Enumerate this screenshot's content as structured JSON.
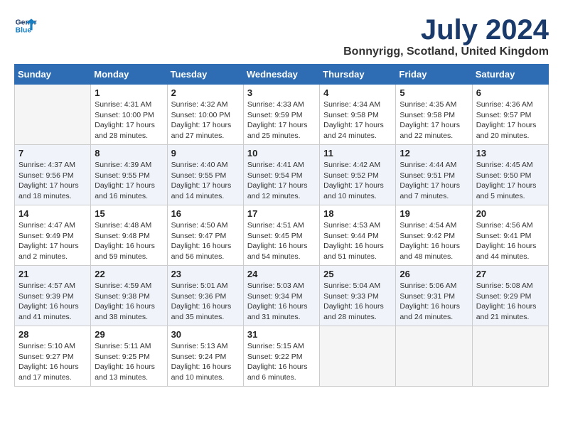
{
  "header": {
    "logo_line1": "General",
    "logo_line2": "Blue",
    "month_title": "July 2024",
    "location": "Bonnyrigg, Scotland, United Kingdom"
  },
  "days_of_week": [
    "Sunday",
    "Monday",
    "Tuesday",
    "Wednesday",
    "Thursday",
    "Friday",
    "Saturday"
  ],
  "weeks": [
    [
      {
        "num": "",
        "empty": true
      },
      {
        "num": "1",
        "sunrise": "Sunrise: 4:31 AM",
        "sunset": "Sunset: 10:00 PM",
        "daylight": "Daylight: 17 hours and 28 minutes."
      },
      {
        "num": "2",
        "sunrise": "Sunrise: 4:32 AM",
        "sunset": "Sunset: 10:00 PM",
        "daylight": "Daylight: 17 hours and 27 minutes."
      },
      {
        "num": "3",
        "sunrise": "Sunrise: 4:33 AM",
        "sunset": "Sunset: 9:59 PM",
        "daylight": "Daylight: 17 hours and 25 minutes."
      },
      {
        "num": "4",
        "sunrise": "Sunrise: 4:34 AM",
        "sunset": "Sunset: 9:58 PM",
        "daylight": "Daylight: 17 hours and 24 minutes."
      },
      {
        "num": "5",
        "sunrise": "Sunrise: 4:35 AM",
        "sunset": "Sunset: 9:58 PM",
        "daylight": "Daylight: 17 hours and 22 minutes."
      },
      {
        "num": "6",
        "sunrise": "Sunrise: 4:36 AM",
        "sunset": "Sunset: 9:57 PM",
        "daylight": "Daylight: 17 hours and 20 minutes."
      }
    ],
    [
      {
        "num": "7",
        "sunrise": "Sunrise: 4:37 AM",
        "sunset": "Sunset: 9:56 PM",
        "daylight": "Daylight: 17 hours and 18 minutes."
      },
      {
        "num": "8",
        "sunrise": "Sunrise: 4:39 AM",
        "sunset": "Sunset: 9:55 PM",
        "daylight": "Daylight: 17 hours and 16 minutes."
      },
      {
        "num": "9",
        "sunrise": "Sunrise: 4:40 AM",
        "sunset": "Sunset: 9:55 PM",
        "daylight": "Daylight: 17 hours and 14 minutes."
      },
      {
        "num": "10",
        "sunrise": "Sunrise: 4:41 AM",
        "sunset": "Sunset: 9:54 PM",
        "daylight": "Daylight: 17 hours and 12 minutes."
      },
      {
        "num": "11",
        "sunrise": "Sunrise: 4:42 AM",
        "sunset": "Sunset: 9:52 PM",
        "daylight": "Daylight: 17 hours and 10 minutes."
      },
      {
        "num": "12",
        "sunrise": "Sunrise: 4:44 AM",
        "sunset": "Sunset: 9:51 PM",
        "daylight": "Daylight: 17 hours and 7 minutes."
      },
      {
        "num": "13",
        "sunrise": "Sunrise: 4:45 AM",
        "sunset": "Sunset: 9:50 PM",
        "daylight": "Daylight: 17 hours and 5 minutes."
      }
    ],
    [
      {
        "num": "14",
        "sunrise": "Sunrise: 4:47 AM",
        "sunset": "Sunset: 9:49 PM",
        "daylight": "Daylight: 17 hours and 2 minutes."
      },
      {
        "num": "15",
        "sunrise": "Sunrise: 4:48 AM",
        "sunset": "Sunset: 9:48 PM",
        "daylight": "Daylight: 16 hours and 59 minutes."
      },
      {
        "num": "16",
        "sunrise": "Sunrise: 4:50 AM",
        "sunset": "Sunset: 9:47 PM",
        "daylight": "Daylight: 16 hours and 56 minutes."
      },
      {
        "num": "17",
        "sunrise": "Sunrise: 4:51 AM",
        "sunset": "Sunset: 9:45 PM",
        "daylight": "Daylight: 16 hours and 54 minutes."
      },
      {
        "num": "18",
        "sunrise": "Sunrise: 4:53 AM",
        "sunset": "Sunset: 9:44 PM",
        "daylight": "Daylight: 16 hours and 51 minutes."
      },
      {
        "num": "19",
        "sunrise": "Sunrise: 4:54 AM",
        "sunset": "Sunset: 9:42 PM",
        "daylight": "Daylight: 16 hours and 48 minutes."
      },
      {
        "num": "20",
        "sunrise": "Sunrise: 4:56 AM",
        "sunset": "Sunset: 9:41 PM",
        "daylight": "Daylight: 16 hours and 44 minutes."
      }
    ],
    [
      {
        "num": "21",
        "sunrise": "Sunrise: 4:57 AM",
        "sunset": "Sunset: 9:39 PM",
        "daylight": "Daylight: 16 hours and 41 minutes."
      },
      {
        "num": "22",
        "sunrise": "Sunrise: 4:59 AM",
        "sunset": "Sunset: 9:38 PM",
        "daylight": "Daylight: 16 hours and 38 minutes."
      },
      {
        "num": "23",
        "sunrise": "Sunrise: 5:01 AM",
        "sunset": "Sunset: 9:36 PM",
        "daylight": "Daylight: 16 hours and 35 minutes."
      },
      {
        "num": "24",
        "sunrise": "Sunrise: 5:03 AM",
        "sunset": "Sunset: 9:34 PM",
        "daylight": "Daylight: 16 hours and 31 minutes."
      },
      {
        "num": "25",
        "sunrise": "Sunrise: 5:04 AM",
        "sunset": "Sunset: 9:33 PM",
        "daylight": "Daylight: 16 hours and 28 minutes."
      },
      {
        "num": "26",
        "sunrise": "Sunrise: 5:06 AM",
        "sunset": "Sunset: 9:31 PM",
        "daylight": "Daylight: 16 hours and 24 minutes."
      },
      {
        "num": "27",
        "sunrise": "Sunrise: 5:08 AM",
        "sunset": "Sunset: 9:29 PM",
        "daylight": "Daylight: 16 hours and 21 minutes."
      }
    ],
    [
      {
        "num": "28",
        "sunrise": "Sunrise: 5:10 AM",
        "sunset": "Sunset: 9:27 PM",
        "daylight": "Daylight: 16 hours and 17 minutes."
      },
      {
        "num": "29",
        "sunrise": "Sunrise: 5:11 AM",
        "sunset": "Sunset: 9:25 PM",
        "daylight": "Daylight: 16 hours and 13 minutes."
      },
      {
        "num": "30",
        "sunrise": "Sunrise: 5:13 AM",
        "sunset": "Sunset: 9:24 PM",
        "daylight": "Daylight: 16 hours and 10 minutes."
      },
      {
        "num": "31",
        "sunrise": "Sunrise: 5:15 AM",
        "sunset": "Sunset: 9:22 PM",
        "daylight": "Daylight: 16 hours and 6 minutes."
      },
      {
        "num": "",
        "empty": true
      },
      {
        "num": "",
        "empty": true
      },
      {
        "num": "",
        "empty": true
      }
    ]
  ]
}
